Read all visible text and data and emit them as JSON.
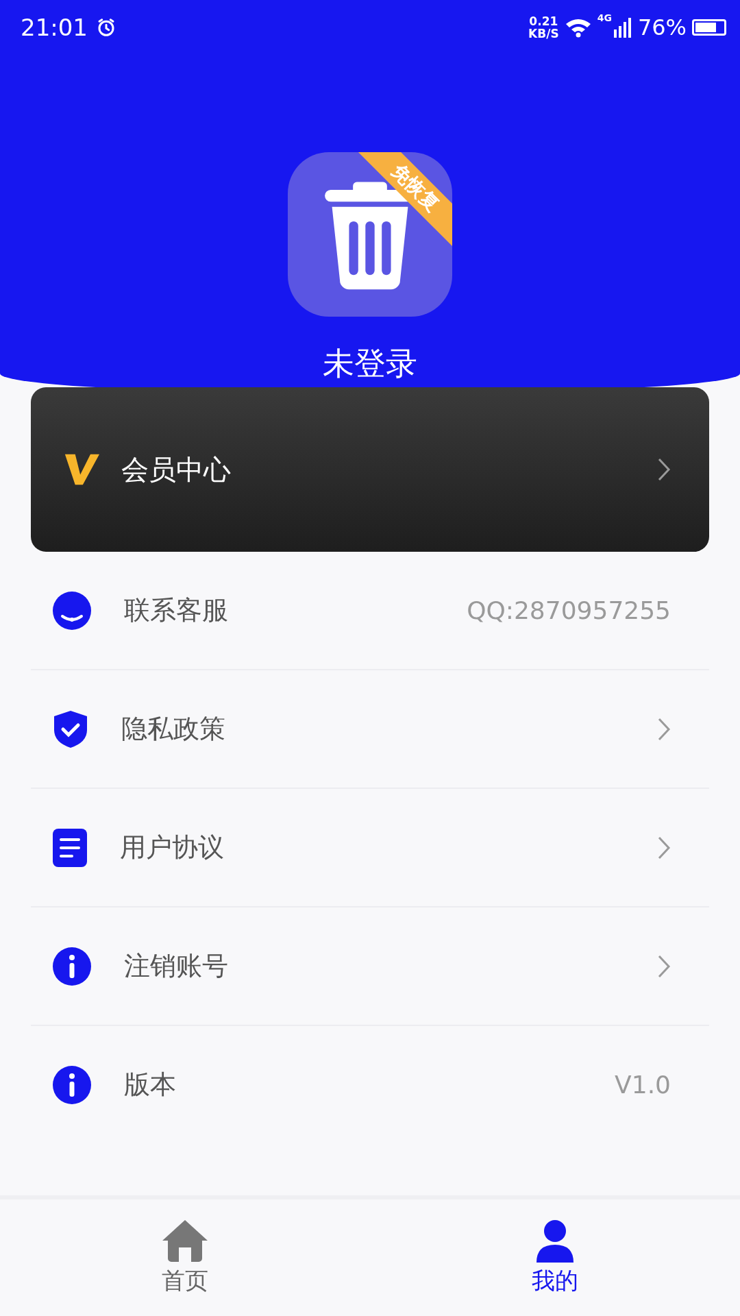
{
  "status_bar": {
    "time": "21:01",
    "net_speed": "0.21",
    "net_unit": "KB/S",
    "network": "4G",
    "battery": "76%"
  },
  "header": {
    "app_badge": "免恢复",
    "user_name": "未登录"
  },
  "member_card": {
    "label": "会员中心"
  },
  "menu": [
    {
      "label": "联系客服",
      "kind": "value",
      "value": "QQ:2870957255"
    },
    {
      "label": "隐私政策",
      "kind": "link"
    },
    {
      "label": "用户协议",
      "kind": "link"
    },
    {
      "label": "注销账号",
      "kind": "link"
    },
    {
      "label": "版本",
      "kind": "value",
      "value": "V1.0"
    }
  ],
  "tabs": [
    {
      "label": "首页",
      "selected": false
    },
    {
      "label": "我的",
      "selected": true
    }
  ]
}
